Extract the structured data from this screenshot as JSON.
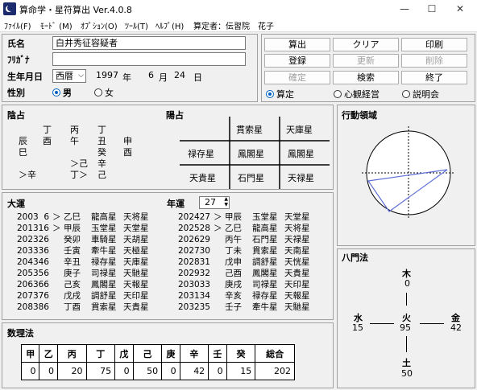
{
  "titlebar": {
    "title": "算命学・星符算出  Ver.4.0.8",
    "minimize": "—",
    "maximize": "☐",
    "close": "✕"
  },
  "menu": [
    "ﾌｧｲﾙ(F)",
    "ﾓｰﾄﾞ (M)",
    "ｵﾌﾟｼｮﾝ(O)",
    "ﾂｰﾙ(T)",
    "ﾍﾙﾌﾟ(H)",
    "算定者：伝習院　花子"
  ],
  "form": {
    "name_label": "氏名",
    "name_value": "白井秀征容疑者",
    "kana_label": "ﾌﾘｶﾞﾅ",
    "kana_value": "",
    "birth_label": "生年月日",
    "era": "西暦",
    "year": "1997",
    "year_unit": "年",
    "month": "6",
    "month_unit": "月",
    "day": "24",
    "day_unit": "日",
    "sex_label": "性別",
    "male": "男",
    "female": "女"
  },
  "buttons": {
    "calc": "算出",
    "clear": "クリア",
    "print": "印刷",
    "register": "登録",
    "update": "更新",
    "delete": "削除",
    "confirm": "確定",
    "search": "検索",
    "exit": "終了"
  },
  "modes": {
    "mode1": "算定",
    "mode2": "心観経営",
    "mode3": "説明会"
  },
  "inyo": {
    "title": "陰占",
    "rows": [
      [
        "",
        "丁",
        "丙",
        "丁",
        ""
      ],
      [
        "辰",
        "酉",
        "午",
        "丑",
        "申"
      ],
      [
        "巳",
        "",
        "",
        "癸",
        "酉"
      ],
      [
        "",
        "",
        "＞己",
        "辛",
        ""
      ],
      [
        "＞辛",
        "",
        "丁＞",
        "己",
        ""
      ]
    ]
  },
  "yosen": {
    "title": "陽占",
    "cells": [
      [
        "",
        "貫索星",
        "天庫星"
      ],
      [
        "禄存星",
        "鳳閣星",
        "鳳閣星"
      ],
      [
        "天貴星",
        "石門星",
        "天禄星"
      ]
    ]
  },
  "action": {
    "title": "行動領域"
  },
  "taiun": {
    "title": "大運",
    "nenun_label": "年運",
    "nenun_value": "27",
    "left": [
      [
        "2003",
        "6",
        "＞",
        "乙巳",
        "龍高星",
        "天将星"
      ],
      [
        "2013",
        "16",
        "＞",
        "甲辰",
        "玉堂星",
        "天堂星"
      ],
      [
        "2023",
        "26",
        "",
        "癸卯",
        "車騎星",
        "天胡星"
      ],
      [
        "2033",
        "36",
        "",
        "壬寅",
        "牽牛星",
        "天極星"
      ],
      [
        "2043",
        "46",
        "",
        "辛丑",
        "禄存星",
        "天庫星"
      ],
      [
        "2053",
        "56",
        "",
        "庚子",
        "司禄星",
        "天馳星"
      ],
      [
        "2063",
        "66",
        "",
        "己亥",
        "鳳閣星",
        "天報星"
      ],
      [
        "2073",
        "76",
        "",
        "戊戌",
        "調舒星",
        "天印星"
      ],
      [
        "2083",
        "86",
        "",
        "丁酉",
        "貫索星",
        "天貴星"
      ]
    ],
    "right": [
      [
        "2024",
        "27",
        "＞",
        "甲辰",
        "玉堂星",
        "天堂星"
      ],
      [
        "2025",
        "28",
        "＞",
        "乙巳",
        "龍高星",
        "天将星"
      ],
      [
        "2026",
        "29",
        "",
        "丙午",
        "石門星",
        "天禄星"
      ],
      [
        "2027",
        "30",
        "",
        "丁未",
        "貫索星",
        "天南星"
      ],
      [
        "2028",
        "31",
        "",
        "戊申",
        "調舒星",
        "天恍星"
      ],
      [
        "2029",
        "32",
        "",
        "己酉",
        "鳳閣星",
        "天貴星"
      ],
      [
        "2030",
        "33",
        "",
        "庚戌",
        "司禄星",
        "天印星"
      ],
      [
        "2031",
        "34",
        "",
        "辛亥",
        "禄存星",
        "天報星"
      ],
      [
        "2032",
        "35",
        "",
        "壬子",
        "牽牛星",
        "天馳星"
      ]
    ]
  },
  "hachimon": {
    "title": "八門法",
    "north": {
      "label": "木",
      "value": "0"
    },
    "west": {
      "label": "水",
      "value": "15"
    },
    "center": {
      "label": "火",
      "value": "95"
    },
    "east": {
      "label": "金",
      "value": "42"
    },
    "south": {
      "label": "土",
      "value": "50"
    }
  },
  "suri": {
    "title": "数理法",
    "headers": [
      "甲",
      "乙",
      "丙",
      "丁",
      "戊",
      "己",
      "庚",
      "辛",
      "壬",
      "癸",
      "総合"
    ],
    "values": [
      "0",
      "0",
      "20",
      "75",
      "0",
      "50",
      "0",
      "42",
      "0",
      "15",
      "202"
    ]
  }
}
